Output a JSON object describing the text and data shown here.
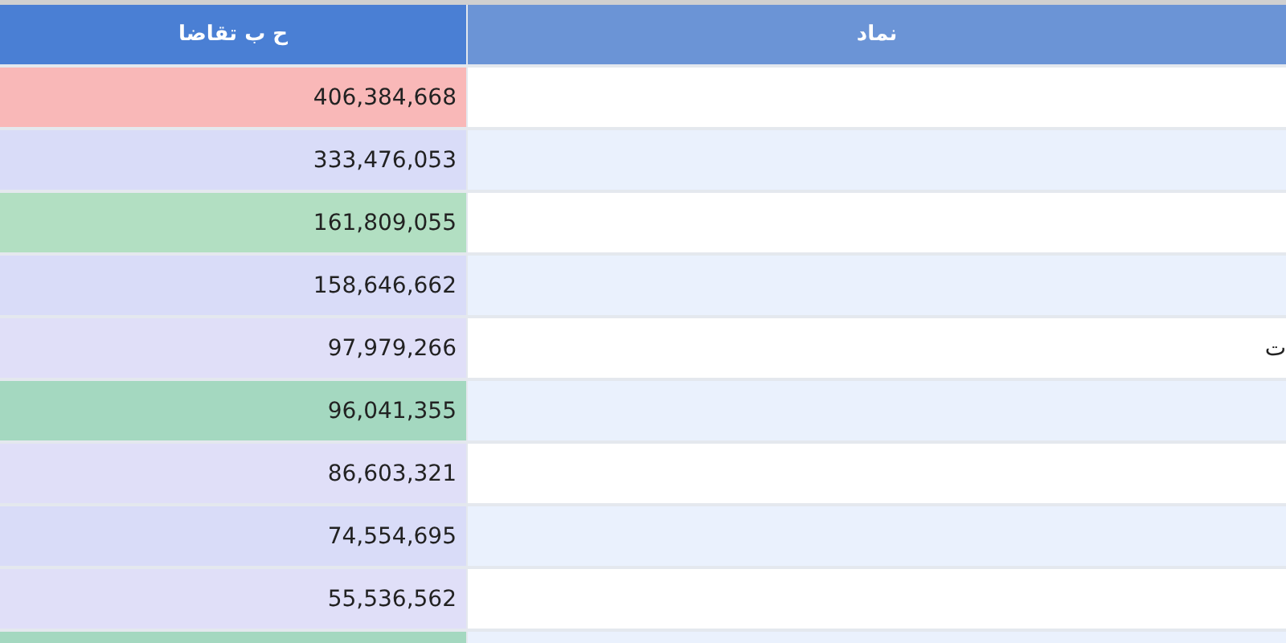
{
  "table": {
    "columns": [
      {
        "label": "نماد"
      },
      {
        "label": "ح ب تقاضا"
      }
    ],
    "rows": [
      {
        "value": "406,384,668",
        "color": "#f9b8b8"
      },
      {
        "value": "333,476,053",
        "color": "#d9dcf8"
      },
      {
        "value": "161,809,055",
        "color": "#b2dfc2"
      },
      {
        "value": "158,646,662",
        "color": "#d9dcf8"
      },
      {
        "symbol": "ت",
        "value": "97,979,266",
        "color": "#e0dff8"
      },
      {
        "value": "96,041,355",
        "color": "#a4d8c0"
      },
      {
        "value": "86,603,321",
        "color": "#e0dff8"
      },
      {
        "value": "74,554,695",
        "color": "#d9dcf8"
      },
      {
        "value": "55,536,562",
        "color": "#e0dff8"
      },
      {
        "color": "#a4d8c0"
      }
    ]
  }
}
